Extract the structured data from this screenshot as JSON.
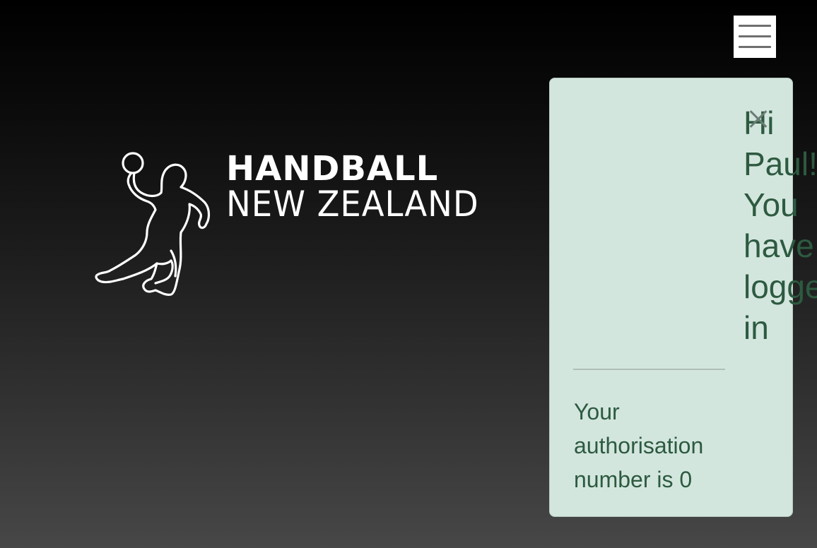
{
  "menu": {
    "icon": "hamburger-menu-icon"
  },
  "logo": {
    "icon": "handball-player-icon",
    "line1": "HANDBALL",
    "line2": "NEW ZEALAND",
    "color": "#ffffff"
  },
  "toast": {
    "heading": "Hi Paul! You have logged in",
    "close_icon": "close-icon",
    "body": "Your authorisation number is 0",
    "background": "#d3e6de",
    "text_color": "#2d5a40"
  }
}
